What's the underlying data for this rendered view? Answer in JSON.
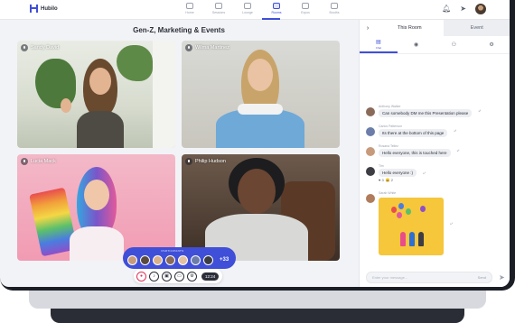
{
  "app": {
    "name": "Hubilo"
  },
  "nav": {
    "items": [
      {
        "label": "Home",
        "active": false
      },
      {
        "label": "Sessions",
        "active": false
      },
      {
        "label": "Lounge",
        "active": false
      },
      {
        "label": "Rooms",
        "active": true
      },
      {
        "label": "Expos",
        "active": false
      },
      {
        "label": "Booths",
        "active": false
      }
    ]
  },
  "room": {
    "title": "Gen-Z, Marketing & Events"
  },
  "tiles": [
    {
      "name": "Sandy David"
    },
    {
      "name": "Wilma Martinez"
    },
    {
      "name": "Lucia Mack"
    },
    {
      "name": "Philip Hudson"
    }
  ],
  "participants": {
    "label": "PARTICIPANTS",
    "more": "+33"
  },
  "controls": {
    "timer": "12:24"
  },
  "panel": {
    "tabs": [
      "This Room",
      "Event"
    ],
    "icon_tabs": [
      {
        "label": "Chat",
        "icon": "chat-icon",
        "active": true
      },
      {
        "label": "",
        "icon": "eye-icon",
        "active": false
      },
      {
        "label": "",
        "icon": "people-icon",
        "active": false
      },
      {
        "label": "",
        "icon": "gear-icon",
        "active": false
      }
    ],
    "messages": [
      {
        "author": "Anthony Walker",
        "text": "Can somebody DM me this Presentation please",
        "color": "#8a6b5a"
      },
      {
        "author": "Carlos Patterson",
        "text": "Its there at the bottom of this page",
        "color": "#6b7da8"
      },
      {
        "author": "Rosana Tellez",
        "text": "Hello everyone, this is touched here",
        "color": "#c79a7c"
      },
      {
        "author": "Tim",
        "text": "Hello everyone :)",
        "color": "#3d3d44",
        "reactions": [
          "♥ 3",
          "😀 2"
        ]
      },
      {
        "author": "Sarah White",
        "text": "",
        "color": "#b07c5b",
        "has_photo": true
      }
    ],
    "composer": {
      "placeholder": "Enter your message...",
      "button": "Send"
    }
  },
  "colors": {
    "accent": "#3f4fd8",
    "danger": "#e0325a"
  }
}
